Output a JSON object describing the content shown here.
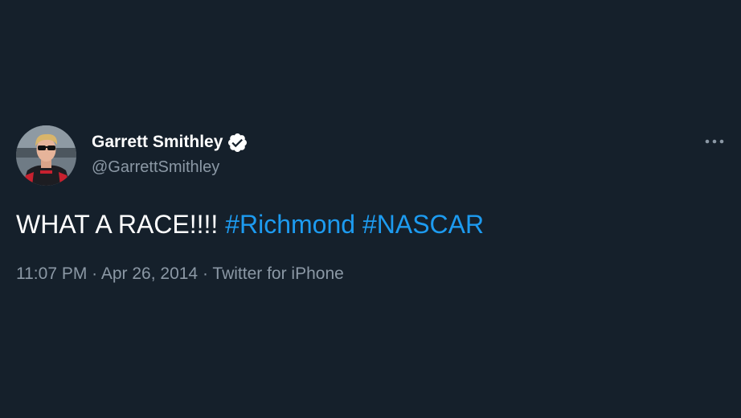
{
  "tweet": {
    "author": {
      "display_name": "Garrett Smithley",
      "handle": "@GarrettSmithley",
      "verified": true
    },
    "text_main": "WHAT A RACE!!!! ",
    "hashtags": [
      "#Richmond",
      "#NASCAR"
    ],
    "time": "11:07 PM",
    "separator": " · ",
    "date": "Apr 26, 2014",
    "source": "Twitter for iPhone"
  },
  "icons": {
    "verified": "verified-badge-icon",
    "more": "more-options-icon"
  },
  "colors": {
    "background": "#15202b",
    "text_primary": "#ffffff",
    "text_secondary": "#8b98a5",
    "hashtag": "#1d9bf0"
  }
}
